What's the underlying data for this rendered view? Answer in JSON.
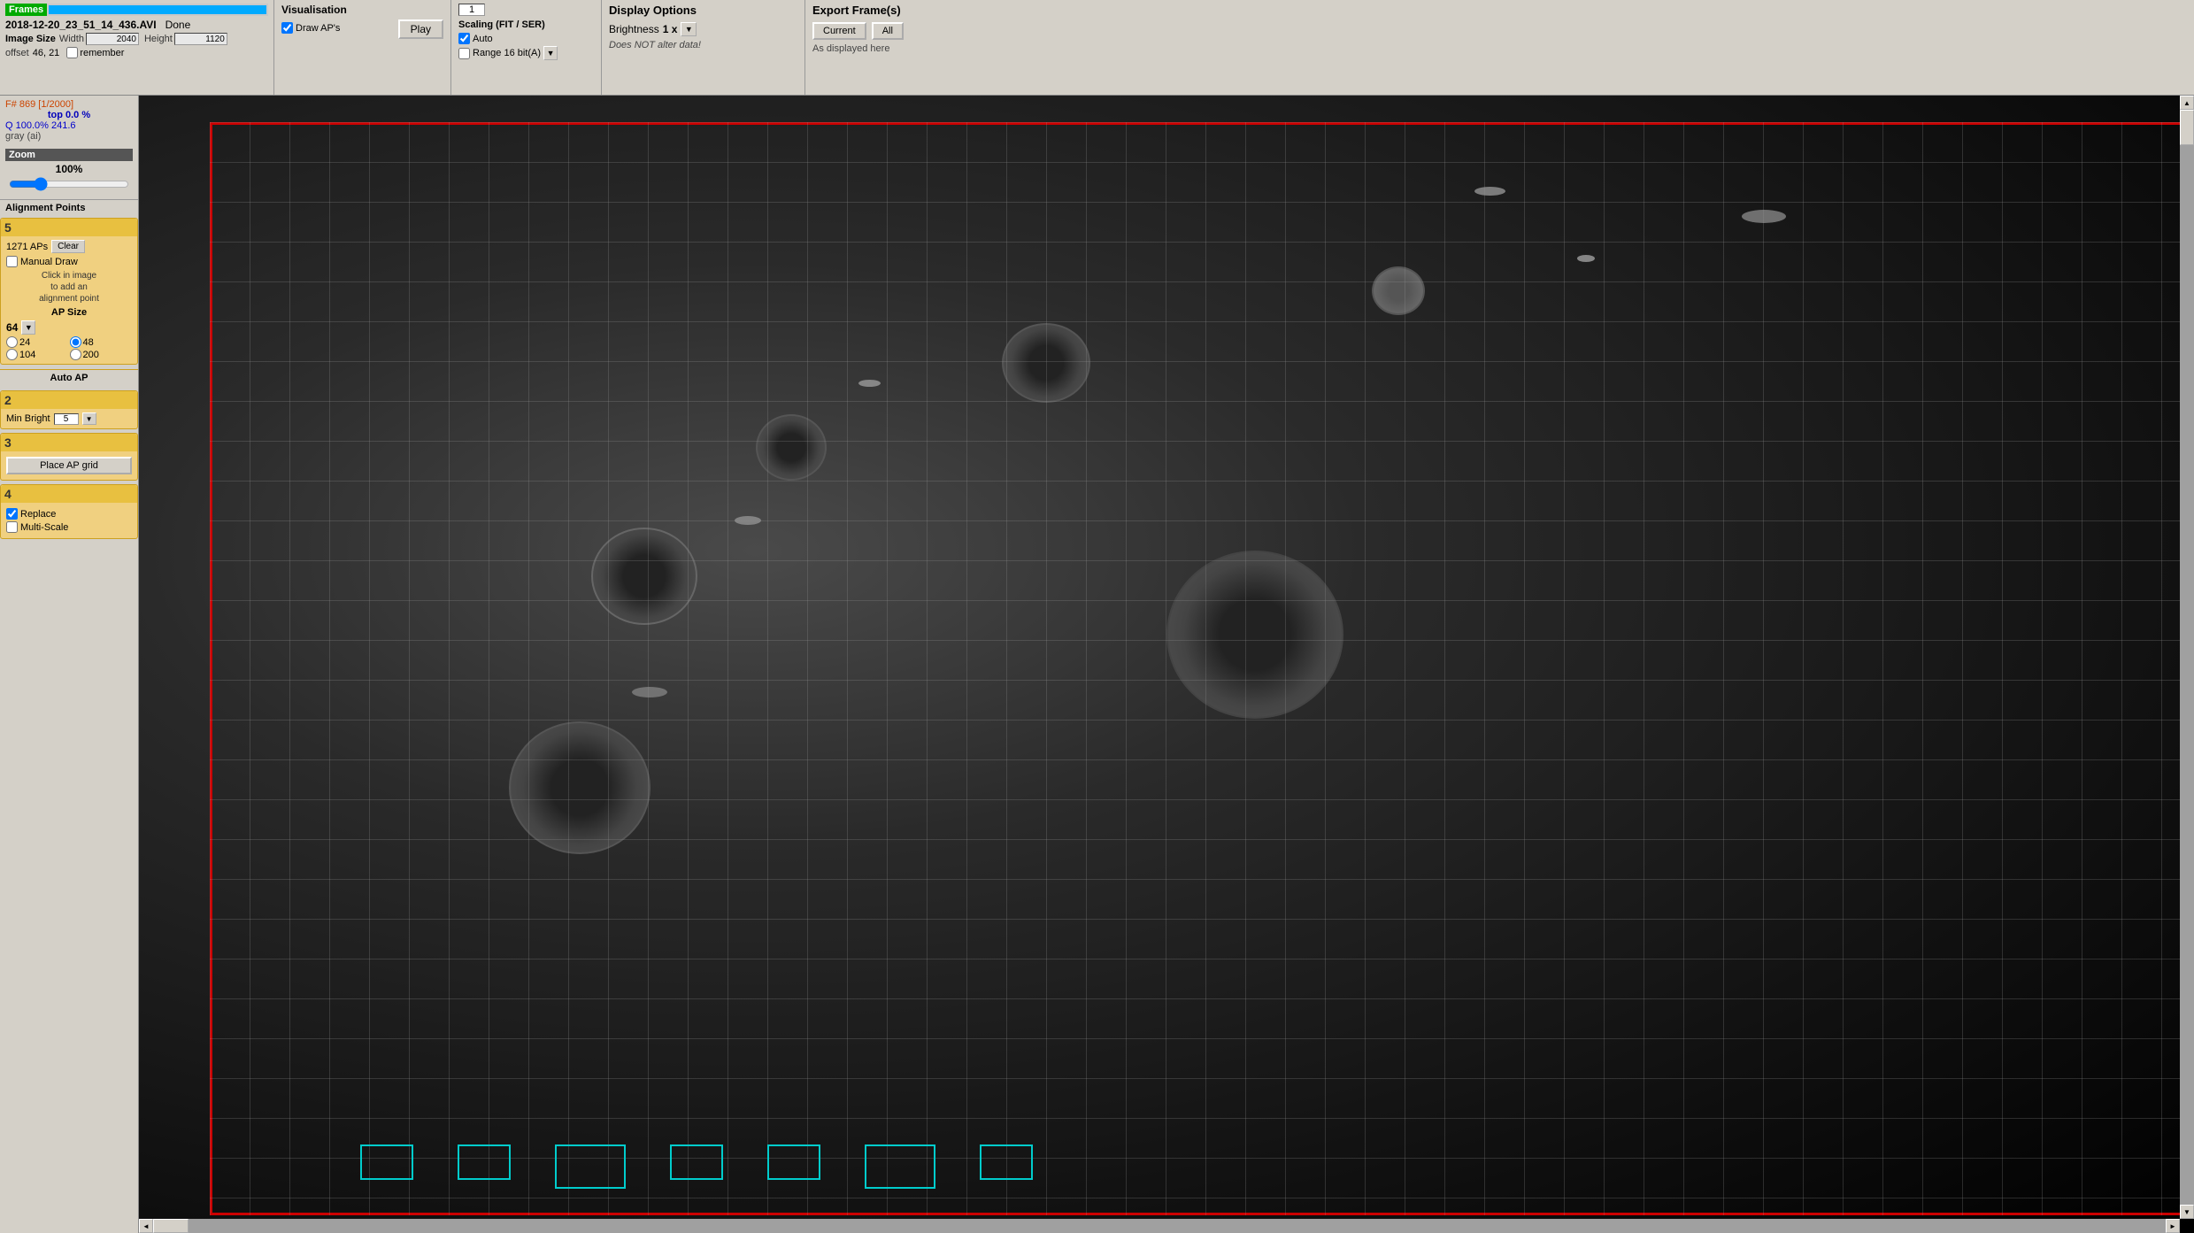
{
  "header": {
    "filename": "2018-12-20_23_51_14_436.AVI",
    "status": "Done",
    "frames_label": "Frames",
    "image_size_label": "Image Size",
    "width_label": "Width",
    "height_label": "Height",
    "width_val": "2040",
    "height_val": "1120",
    "offset_label": "offset",
    "offset_val": "46, 21",
    "remember_label": "remember",
    "vis_title": "Visualisation",
    "draw_aps_label": "Draw AP's",
    "play_label": "Play",
    "frame_num": "1",
    "scaling_title": "Scaling (FIT / SER)",
    "auto_label": "Auto",
    "range_label": "Range 16 bit(A)",
    "display_title": "Display Options",
    "brightness_label": "Brightness",
    "brightness_val": "1 x",
    "does_not_alter": "Does NOT alter data!",
    "export_title": "Export Frame(s)",
    "current_label": "Current",
    "all_label": "All",
    "as_displayed_label": "As displayed here"
  },
  "left_panel": {
    "frame_info": "F# 869 [1/2000]",
    "frame_top": "top 0.0 %",
    "frame_q": "Q 100.0%  241.6",
    "frame_gray": "gray (ai)",
    "zoom_title": "Zoom",
    "zoom_val": "100%",
    "alignment_title": "Alignment Points",
    "step5_num": "5",
    "ap_count": "1271 APs",
    "clear_label": "Clear",
    "manual_draw_label": "Manual Draw",
    "click_info": "Click in image\nto add an\nalignment point",
    "ap_size_title": "AP Size",
    "ap_size_val": "64",
    "ap_r24": "24",
    "ap_r48": "48",
    "ap_r104": "104",
    "ap_r200": "200",
    "auto_ap_title": "Auto AP",
    "step2_num": "2",
    "min_bright_label": "Min Bright",
    "min_bright_val": "5",
    "step3_num": "3",
    "place_ap_label": "Place AP grid",
    "step4_num": "4",
    "replace_label": "Replace",
    "multiscale_label": "Multi-Scale"
  }
}
